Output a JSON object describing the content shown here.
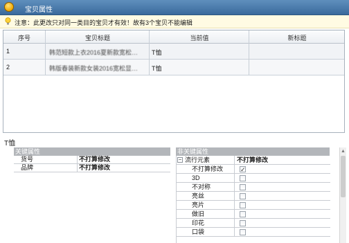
{
  "window": {
    "title": "宝贝属性"
  },
  "notice": {
    "text": "注意：此更改只对同一类目的宝贝才有效！故有3个宝贝不能编辑"
  },
  "top_table": {
    "columns": [
      "序号",
      "宝贝标题",
      "当前值",
      "新标题"
    ],
    "rows": [
      {
        "index": "1",
        "title": "韩范短款上衣2016夏新款宽松…",
        "current": "T恤",
        "new": ""
      },
      {
        "index": "2",
        "title": "韩版春装新款女装2016宽松显…",
        "current": "T恤",
        "new": ""
      }
    ]
  },
  "lower_label": "T恤",
  "key_properties": {
    "header": "关键属性",
    "rows": [
      {
        "name": "货号",
        "value": "不打算修改"
      },
      {
        "name": "品牌",
        "value": "不打算修改"
      }
    ]
  },
  "nonkey_properties": {
    "header": "非关键属性",
    "group": {
      "name": "流行元素",
      "value": "不打算修改",
      "expander": "−"
    },
    "items": [
      {
        "label": "不打算修改",
        "checked": true
      },
      {
        "label": "3D",
        "checked": false
      },
      {
        "label": "不对称",
        "checked": false
      },
      {
        "label": "亮丝",
        "checked": false
      },
      {
        "label": "亮片",
        "checked": false
      },
      {
        "label": "做旧",
        "checked": false
      },
      {
        "label": "印花",
        "checked": false
      },
      {
        "label": "口袋",
        "checked": false
      }
    ]
  },
  "colors": {
    "titlebar": "#4a7aac",
    "notice_bg": "#fffbe3",
    "section_header": "#b3b6ba"
  },
  "icons": {
    "app": "app-icon",
    "notice": "lightbulb-icon",
    "expander": "collapse-icon"
  }
}
